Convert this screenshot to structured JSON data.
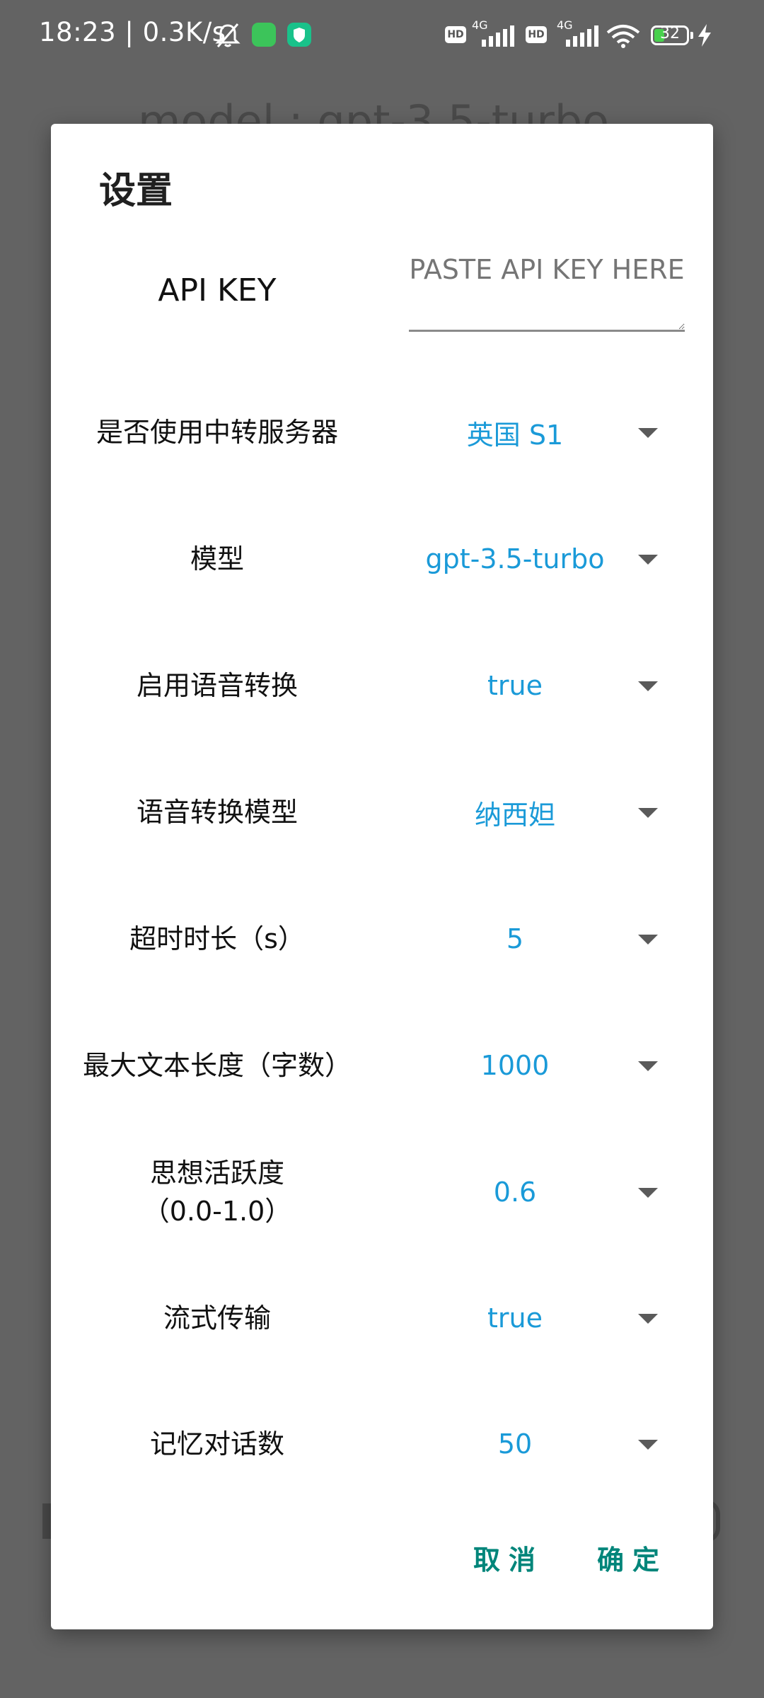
{
  "status_bar": {
    "time": "18:23",
    "speed": "| 0.3K/s",
    "hd1": "HD",
    "net1": "4G",
    "hd2": "HD",
    "net2": "4G",
    "battery": "32",
    "battery_color": "#48d04d",
    "icons": [
      "bell-off-icon",
      "app-icon-green",
      "shield-app-icon",
      "signal-icon",
      "wifi-icon",
      "battery-icon",
      "charging-bolt-icon"
    ]
  },
  "background": {
    "model_text": "model : gpt-3.5-turbo"
  },
  "dialog": {
    "title": "设置",
    "api_key": {
      "label": "API KEY",
      "placeholder": "PASTE API KEY HERE",
      "value": ""
    },
    "rows": [
      {
        "label": "是否使用中转服务器",
        "value": "英国 S1"
      },
      {
        "label": "模型",
        "value": "gpt-3.5-turbo"
      },
      {
        "label": "启用语音转换",
        "value": "true"
      },
      {
        "label": "语音转换模型",
        "value": "纳西妲"
      },
      {
        "label": "超时时长（s）",
        "value": "5"
      },
      {
        "label": "最大文本长度（字数）",
        "value": "1000"
      },
      {
        "label": "思想活跃度\n（0.0-1.0）",
        "value": "0.6"
      },
      {
        "label": "流式传输",
        "value": "true"
      },
      {
        "label": "记忆对话数",
        "value": "50"
      }
    ],
    "cancel_label": "取消",
    "confirm_label": "确定",
    "accent_color": "#00857a",
    "value_color": "#1a9ad8"
  }
}
